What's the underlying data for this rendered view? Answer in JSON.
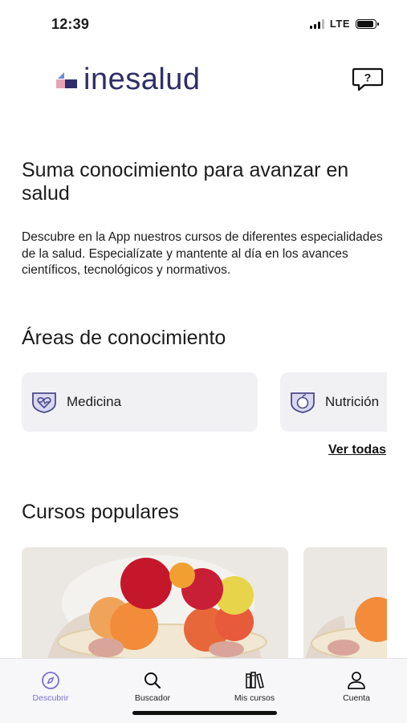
{
  "status_bar": {
    "time": "12:39",
    "network": "LTE"
  },
  "header": {
    "brand": "inesalud",
    "help_icon": "chat-question-icon"
  },
  "hero": {
    "title": "Suma conocimiento para avanzar en salud",
    "description": "Descubre en la App nuestros cursos de diferentes especialidades de la salud. Especialízate y mantente al día en los avances científicos, tecnológicos y normativos."
  },
  "areas": {
    "title": "Áreas de conocimiento",
    "items": [
      {
        "label": "Medicina",
        "icon": "heart-shield-icon"
      },
      {
        "label": "Nutrición",
        "icon": "apple-shield-icon"
      }
    ],
    "see_all": "Ver todas"
  },
  "popular": {
    "title": "Cursos populares",
    "courses": [
      {
        "image": "fruit-bowl-photo"
      },
      {
        "image": "fruit-bowl-photo"
      }
    ]
  },
  "tabs": [
    {
      "label": "Descubrir",
      "icon": "compass-icon",
      "active": true
    },
    {
      "label": "Buscador",
      "icon": "search-icon",
      "active": false
    },
    {
      "label": "Mis cursos",
      "icon": "books-icon",
      "active": false
    },
    {
      "label": "Cuenta",
      "icon": "user-icon",
      "active": false
    }
  ],
  "colors": {
    "brand": "#2e2e6a",
    "accent": "#7b6fd3",
    "card_bg": "#f1f1f4"
  }
}
